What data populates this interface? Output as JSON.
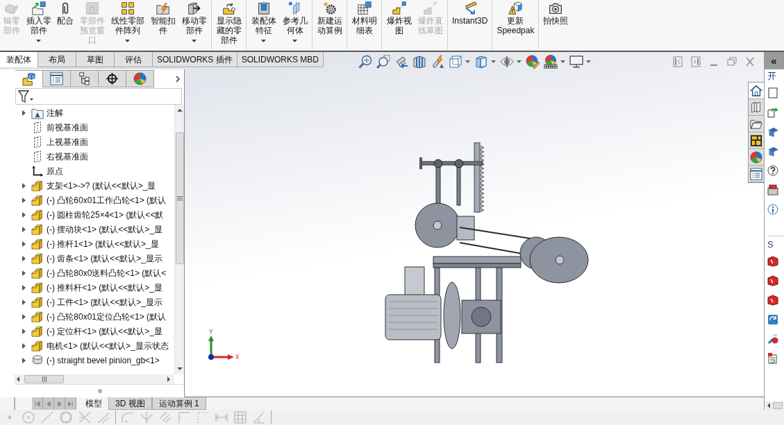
{
  "command_manager": {
    "groups": [
      [
        {
          "kind": "edit-component",
          "label": "辑零部件",
          "disabled": true,
          "dropdown": false
        },
        {
          "kind": "insert-component",
          "label": "插入零部件",
          "disabled": false,
          "dropdown": true
        },
        {
          "kind": "mate",
          "label": "配合",
          "disabled": false,
          "dropdown": false
        },
        {
          "kind": "preview-window",
          "label": "零部件预览窗口",
          "disabled": true,
          "dropdown": false
        },
        {
          "kind": "linear-pattern",
          "label": "线性零部件阵列",
          "disabled": false,
          "dropdown": true
        },
        {
          "kind": "smart-fastener",
          "label": "智能扣件",
          "disabled": false,
          "dropdown": false
        },
        {
          "kind": "move-component",
          "label": "移动零部件",
          "disabled": false,
          "dropdown": true
        }
      ],
      [
        {
          "kind": "show-hidden",
          "label": "显示隐藏的零部件",
          "disabled": false,
          "dropdown": false
        }
      ],
      [
        {
          "kind": "assembly-feature",
          "label": "装配体特征",
          "disabled": false,
          "dropdown": true
        },
        {
          "kind": "reference-geometry",
          "label": "参考几何体",
          "disabled": false,
          "dropdown": true
        }
      ],
      [
        {
          "kind": "motion-study",
          "label": "新建运动算例",
          "disabled": false,
          "dropdown": false
        }
      ],
      [
        {
          "kind": "bom",
          "label": "材料明细表",
          "disabled": false,
          "dropdown": false
        }
      ],
      [
        {
          "kind": "exploded-view",
          "label": "爆炸视图",
          "disabled": false,
          "dropdown": false
        },
        {
          "kind": "explode-line",
          "label": "爆炸直线草图",
          "disabled": true,
          "dropdown": false
        }
      ],
      [
        {
          "kind": "instant3d",
          "label": "Instant3D",
          "disabled": false,
          "dropdown": false
        }
      ],
      [
        {
          "kind": "speedpak",
          "label": "更新 Speedpak",
          "disabled": false,
          "dropdown": false
        }
      ],
      [
        {
          "kind": "snapshot",
          "label": "拍快照",
          "disabled": false,
          "dropdown": false
        }
      ]
    ]
  },
  "command_tabs": [
    {
      "label": "装配体",
      "selected": true
    },
    {
      "label": "布局",
      "selected": false
    },
    {
      "label": "草图",
      "selected": false
    },
    {
      "label": "评估",
      "selected": false
    },
    {
      "label": "SOLIDWORKS 插件",
      "selected": false
    },
    {
      "label": "SOLIDWORKS MBD",
      "selected": false
    }
  ],
  "view_toolbar": [
    {
      "kind": "zoom-fit",
      "dropdown": false
    },
    {
      "kind": "zoom-area",
      "dropdown": false
    },
    {
      "kind": "previous-view",
      "dropdown": false
    },
    {
      "kind": "section-view",
      "dropdown": false
    },
    {
      "kind": "dynamic-annotation",
      "dropdown": false
    },
    {
      "kind": "view-orientation",
      "dropdown": true
    },
    {
      "kind": "display-style",
      "dropdown": true
    },
    {
      "kind": "hide-show",
      "dropdown": true
    },
    {
      "kind": "edit-appearance",
      "dropdown": false
    },
    {
      "kind": "apply-scene",
      "dropdown": true
    },
    {
      "kind": "view-settings",
      "dropdown": true
    }
  ],
  "window_controls": [
    {
      "kind": "tile-left"
    },
    {
      "kind": "tile-right"
    },
    {
      "kind": "minimize"
    },
    {
      "kind": "restore"
    },
    {
      "kind": "close"
    }
  ],
  "feature_manager": {
    "tabs": [
      {
        "kind": "assembly",
        "selected": true
      },
      {
        "kind": "properties",
        "selected": false
      },
      {
        "kind": "configurations",
        "selected": false
      },
      {
        "kind": "dimxpert",
        "selected": false
      },
      {
        "kind": "display",
        "selected": false
      }
    ],
    "tree": [
      {
        "kind": "annotations",
        "label": "注解",
        "expandable": true
      },
      {
        "kind": "plane",
        "label": "前视基准面",
        "expandable": false
      },
      {
        "kind": "plane",
        "label": "上视基准面",
        "expandable": false
      },
      {
        "kind": "plane",
        "label": "右视基准面",
        "expandable": false
      },
      {
        "kind": "origin",
        "label": "原点",
        "expandable": false
      },
      {
        "kind": "part",
        "label": "支架<1>->? (默认<<默认>_显",
        "expandable": true
      },
      {
        "kind": "part",
        "label": "(-) 凸轮60x01工作凸轮<1> (默认",
        "expandable": true
      },
      {
        "kind": "part",
        "label": "(-) 圆柱齿轮25×4<1> (默认<<默",
        "expandable": true
      },
      {
        "kind": "part",
        "label": "(-) 摆动块<1> (默认<<默认>_显",
        "expandable": true
      },
      {
        "kind": "part",
        "label": "(-) 推杆1<1> (默认<<默认>_显",
        "expandable": true
      },
      {
        "kind": "part",
        "label": "(-) 齿条<1> (默认<<默认>_显示",
        "expandable": true
      },
      {
        "kind": "part",
        "label": "(-) 凸轮80x0送料凸轮<1> (默认<",
        "expandable": true
      },
      {
        "kind": "part",
        "label": "(-) 推料杆<1> (默认<<默认>_显",
        "expandable": true
      },
      {
        "kind": "part",
        "label": "(-) 工件<1> (默认<<默认>_显示",
        "expandable": true
      },
      {
        "kind": "part",
        "label": "(-) 凸轮80x01定位凸轮<1> (默认",
        "expandable": true
      },
      {
        "kind": "part",
        "label": "(-) 定位杆<1> (默认<<默认>_显",
        "expandable": true
      },
      {
        "kind": "part",
        "label": "电机<1> (默认<<默认>_显示状态",
        "expandable": true
      },
      {
        "kind": "toolbox-part",
        "label": "(-) straight bevel pinion_gb<1>",
        "expandable": true
      }
    ]
  },
  "model_tabs": [
    {
      "label": "模型",
      "selected": true
    },
    {
      "label": "3D 视图",
      "selected": false
    },
    {
      "label": "运动算例 1",
      "selected": false
    }
  ],
  "triad": {
    "y_label": "Y",
    "x_label": "X"
  },
  "task_pane": {
    "collapse": "«",
    "tabs": [
      {
        "kind": "home",
        "selected": true
      },
      {
        "kind": "library",
        "selected": false
      },
      {
        "kind": "file-explorer",
        "selected": false
      },
      {
        "kind": "view-palette",
        "selected": false
      },
      {
        "kind": "appearances",
        "selected": false
      },
      {
        "kind": "custom-properties",
        "selected": false
      }
    ],
    "sections": [
      {
        "title": "开",
        "items": [
          {
            "kind": "new-document"
          },
          {
            "kind": "open-document"
          },
          {
            "kind": "tutorial"
          },
          {
            "kind": "tutorial"
          },
          {
            "kind": "help"
          },
          {
            "kind": "toolbox"
          },
          {
            "kind": "info"
          }
        ]
      },
      {
        "title": "S",
        "items": [
          {
            "kind": "red-cube"
          },
          {
            "kind": "red-cube"
          },
          {
            "kind": "red-cube"
          },
          {
            "kind": "sync"
          },
          {
            "kind": "gear-wrench"
          },
          {
            "kind": "checklist"
          }
        ]
      }
    ]
  },
  "sketch_toolbar": {
    "disabled": true,
    "tools": [
      {
        "kind": "point"
      },
      {
        "kind": "circle"
      },
      {
        "kind": "line"
      },
      {
        "kind": "polygon"
      },
      {
        "kind": "trim"
      },
      {
        "kind": "angle-line"
      },
      {
        "kind": "separator"
      },
      {
        "kind": "fillet"
      },
      {
        "kind": "mirror"
      },
      {
        "kind": "offset"
      },
      {
        "kind": "corner"
      },
      {
        "kind": "dotted-rect"
      },
      {
        "kind": "dimension"
      },
      {
        "kind": "grid"
      },
      {
        "kind": "angle"
      },
      {
        "kind": "separator"
      }
    ]
  }
}
